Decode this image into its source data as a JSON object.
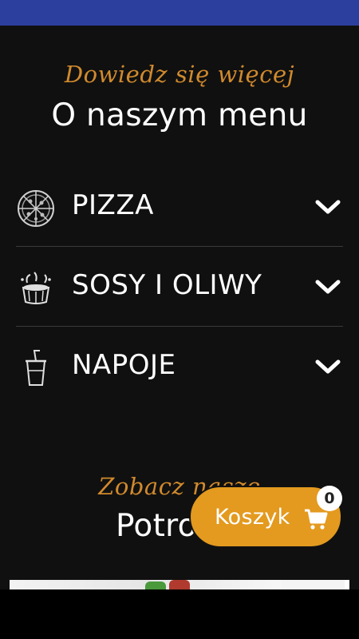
{
  "menu_section": {
    "subtitle": "Dowiedz się więcej",
    "title": "O naszym menu",
    "items": [
      {
        "label": "PIZZA",
        "icon": "pizza-icon"
      },
      {
        "label": "SOSY I OLIWY",
        "icon": "sauce-icon"
      },
      {
        "label": "NAPOJE",
        "icon": "drink-icon"
      }
    ]
  },
  "featured_section": {
    "subtitle": "Zobacz nasze",
    "title_visible": "Potro"
  },
  "cart": {
    "label": "Koszyk",
    "count": "0"
  },
  "colors": {
    "accent": "#d18a2d",
    "cart_button": "#e39a1f",
    "status_bar": "#2d3f9e",
    "background": "#101010"
  }
}
